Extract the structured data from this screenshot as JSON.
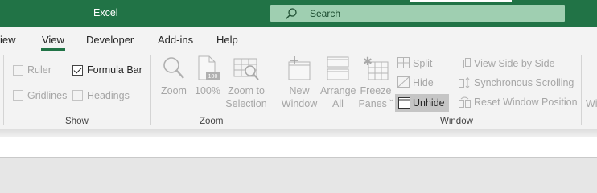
{
  "app": {
    "title": "Excel",
    "title_bar_color": "#217346"
  },
  "search": {
    "label": "Search",
    "icon": "search-icon"
  },
  "tabs": [
    {
      "label": "iew",
      "active": false
    },
    {
      "label": "View",
      "active": true
    },
    {
      "label": "Developer",
      "active": false
    },
    {
      "label": "Add-ins",
      "active": false
    },
    {
      "label": "Help",
      "active": false
    }
  ],
  "show_group": {
    "label": "Show",
    "checkboxes": [
      {
        "label": "Ruler",
        "checked": false,
        "enabled": false
      },
      {
        "label": "Formula Bar",
        "checked": true,
        "enabled": true
      },
      {
        "label": "Gridlines",
        "checked": false,
        "enabled": false
      },
      {
        "label": "Headings",
        "checked": false,
        "enabled": false
      }
    ]
  },
  "zoom_group": {
    "label": "Zoom",
    "buttons": [
      {
        "line1": "Zoom",
        "line2": "",
        "icon": "magnifier-icon"
      },
      {
        "line1": "100%",
        "line2": "",
        "icon": "zoom-100-icon"
      },
      {
        "line1": "Zoom to",
        "line2": "Selection",
        "icon": "zoom-to-selection-icon"
      }
    ]
  },
  "window_group": {
    "label": "Window",
    "buttons": [
      {
        "line1": "New",
        "line2": "Window",
        "icon": "new-window-icon"
      },
      {
        "line1": "Arrange",
        "line2": "All",
        "icon": "arrange-all-icon"
      },
      {
        "line1": "Freeze",
        "line2": "Panes ˇ",
        "icon": "freeze-panes-icon"
      }
    ],
    "small_buttons": [
      {
        "label": "Split",
        "icon": "split-icon",
        "enabled": false
      },
      {
        "label": "Hide",
        "icon": "hide-icon",
        "enabled": false
      },
      {
        "label": "Unhide",
        "icon": "unhide-icon",
        "enabled": true,
        "highlighted": true
      }
    ],
    "side_buttons": [
      {
        "label": "View Side by Side",
        "icon": "side-by-side-icon"
      },
      {
        "label": "Synchronous Scrolling",
        "icon": "sync-scroll-icon"
      },
      {
        "label": "Reset Window Position",
        "icon": "reset-window-icon"
      }
    ],
    "clipped_next": "Wi"
  }
}
